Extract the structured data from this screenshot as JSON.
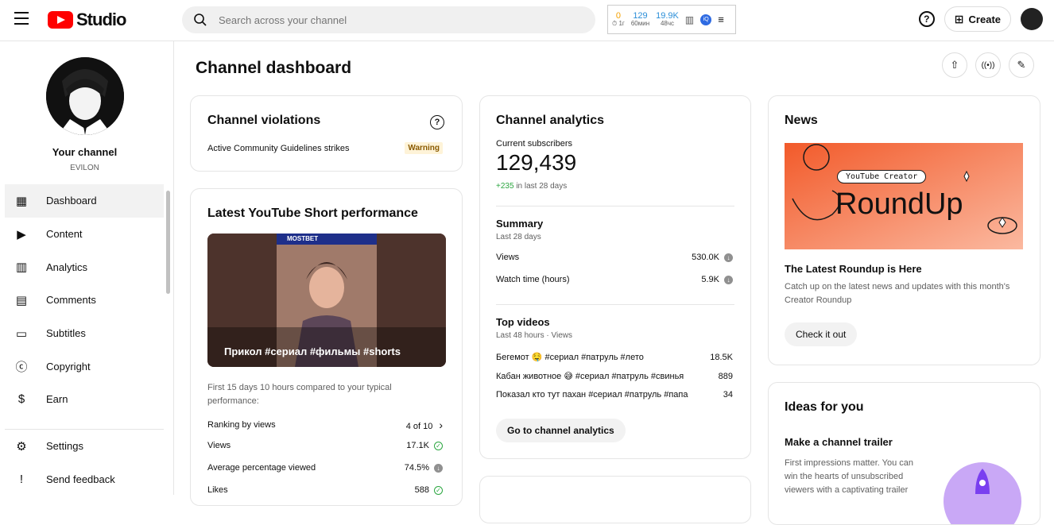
{
  "header": {
    "logo_text": "Studio",
    "search_placeholder": "Search across your channel",
    "extension": {
      "stat1_value": "0",
      "stat1_label": "⏱ 1г",
      "stat2_value": "129",
      "stat2_label": "60мин",
      "stat3_value": "19.9K",
      "stat3_label": "48чс",
      "badge": "iQ"
    },
    "create_label": "Create"
  },
  "sidebar": {
    "channel_name": "Your channel",
    "channel_handle": "EVILON",
    "items": [
      {
        "label": "Dashboard",
        "icon": "dashboard-icon",
        "glyph": "▦"
      },
      {
        "label": "Content",
        "icon": "content-icon",
        "glyph": "▶"
      },
      {
        "label": "Analytics",
        "icon": "analytics-icon",
        "glyph": "▥"
      },
      {
        "label": "Comments",
        "icon": "comments-icon",
        "glyph": "▤"
      },
      {
        "label": "Subtitles",
        "icon": "subtitles-icon",
        "glyph": "▭"
      },
      {
        "label": "Copyright",
        "icon": "copyright-icon",
        "glyph": "ⓒ"
      },
      {
        "label": "Earn",
        "icon": "earn-icon",
        "glyph": "$"
      }
    ],
    "bottom": [
      {
        "label": "Settings",
        "icon": "gear-icon",
        "glyph": "⚙"
      },
      {
        "label": "Send feedback",
        "icon": "feedback-icon",
        "glyph": "!"
      }
    ]
  },
  "main": {
    "title": "Channel dashboard",
    "violations": {
      "title": "Channel violations",
      "row_label": "Active Community Guidelines strikes",
      "row_badge": "Warning"
    },
    "short_perf": {
      "title": "Latest YouTube Short performance",
      "thumb_caption": "Прикол #сериал #фильмы #shorts",
      "thumb_banner": "MOSTBET",
      "note": "First 15 days 10 hours compared to your typical performance:",
      "rows": [
        {
          "label": "Ranking by views",
          "value": "4 of 10",
          "icon": "chevron-right-icon",
          "glyph": "›"
        },
        {
          "label": "Views",
          "value": "17.1K",
          "icon": "check-circle-icon",
          "glyph": "✓"
        },
        {
          "label": "Average percentage viewed",
          "value": "74.5%",
          "icon": "arrow-down-circle-icon",
          "glyph": "↓"
        },
        {
          "label": "Likes",
          "value": "588",
          "icon": "check-circle-icon",
          "glyph": "✓"
        }
      ]
    },
    "analytics": {
      "title": "Channel analytics",
      "subs_label": "Current subscribers",
      "subs_value": "129,439",
      "subs_delta": "+235",
      "subs_delta_suffix": "in last 28 days",
      "summary_title": "Summary",
      "summary_period": "Last 28 days",
      "summary_rows": [
        {
          "label": "Views",
          "value": "530.0K"
        },
        {
          "label": "Watch time (hours)",
          "value": "5.9K"
        }
      ],
      "top_title": "Top videos",
      "top_period": "Last 48 hours · Views",
      "top_rows": [
        {
          "label": "Бегемот 🤤 #сериал #патруль #лето",
          "value": "18.5K"
        },
        {
          "label": "Кабан животное 😅 #сериал #патруль #свинья",
          "value": "889"
        },
        {
          "label": "Показал кто тут пахан #сериал #патруль #папа",
          "value": "34"
        }
      ],
      "button": "Go to channel analytics"
    },
    "news": {
      "title": "News",
      "banner_tag": "YouTube Creator",
      "banner_title": "RoundUp",
      "headline": "The Latest Roundup is Here",
      "body": "Catch up on the latest news and updates with this month's Creator Roundup",
      "button": "Check it out"
    },
    "ideas": {
      "title": "Ideas for you",
      "headline": "Make a channel trailer",
      "body": "First impressions matter. You can win the hearts of unsubscribed viewers with a captivating trailer"
    }
  },
  "colors": {
    "brand": "#ff0000",
    "news_banner": "#f26a2e",
    "green": "#2ba640"
  }
}
